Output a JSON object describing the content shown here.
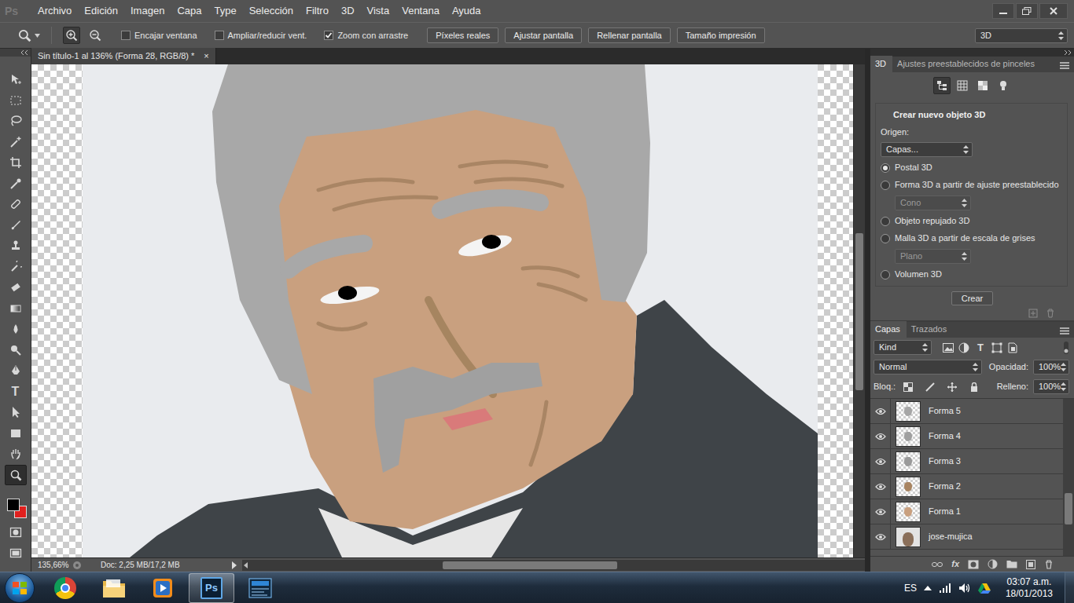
{
  "app_logo": "Ps",
  "menu": [
    "Archivo",
    "Edición",
    "Imagen",
    "Capa",
    "Type",
    "Selección",
    "Filtro",
    "3D",
    "Vista",
    "Ventana",
    "Ayuda"
  ],
  "options_bar": {
    "checkboxes": [
      {
        "label": "Encajar ventana",
        "checked": false
      },
      {
        "label": "Ampliar/reducir vent.",
        "checked": false
      },
      {
        "label": "Zoom con arrastre",
        "checked": true
      }
    ],
    "buttons": [
      "Píxeles reales",
      "Ajustar pantalla",
      "Rellenar pantalla",
      "Tamaño impresión"
    ],
    "workspace": "3D"
  },
  "document": {
    "tab_title": "Sin título-1 al 136% (Forma 28, RGB/8) *",
    "close": "×",
    "zoom": "135,66%",
    "doc_info": "Doc: 2,25 MB/17,2 MB"
  },
  "tools": [
    {
      "kind": "icon",
      "selected": false
    },
    {
      "kind": "icon",
      "selected": false
    },
    {
      "kind": "icon",
      "selected": false
    },
    {
      "kind": "icon",
      "selected": false
    },
    {
      "kind": "icon",
      "selected": false
    },
    {
      "kind": "icon",
      "selected": false
    },
    {
      "kind": "icon",
      "selected": false
    },
    {
      "kind": "icon",
      "selected": false
    },
    {
      "kind": "icon",
      "selected": false
    },
    {
      "kind": "icon",
      "selected": false
    },
    {
      "kind": "icon",
      "selected": false
    },
    {
      "kind": "icon",
      "selected": false
    },
    {
      "kind": "icon",
      "selected": false
    },
    {
      "kind": "icon",
      "selected": false
    },
    {
      "kind": "icon",
      "selected": false
    },
    {
      "kind": "glyph",
      "glyph": "T",
      "selected": false
    },
    {
      "kind": "icon",
      "selected": false
    },
    {
      "kind": "icon",
      "selected": false
    },
    {
      "kind": "icon",
      "selected": false
    },
    {
      "kind": "icon",
      "selected": true
    }
  ],
  "colors": {
    "foreground": "#000000",
    "background": "#e0201e"
  },
  "panel_3d": {
    "tabs": [
      {
        "label": "3D",
        "selected": true
      },
      {
        "label": "Ajustes preestablecidos de pinceles",
        "selected": false
      }
    ],
    "view_buttons": [
      {
        "selected": true
      },
      {
        "selected": false
      },
      {
        "selected": false
      },
      {
        "selected": false
      }
    ],
    "heading": "Crear nuevo objeto 3D",
    "source_label": "Origen:",
    "source": "Capas...",
    "options": [
      {
        "kind": "radio",
        "label": "Postal 3D",
        "selected": true,
        "disabled": false
      },
      {
        "kind": "radio",
        "label": "Forma 3D a partir de ajuste preestablecido",
        "selected": false,
        "disabled": false
      },
      {
        "kind": "select",
        "label": "Cono",
        "selected": false,
        "disabled": true
      },
      {
        "kind": "radio",
        "label": "Objeto repujado 3D",
        "selected": false,
        "disabled": false
      },
      {
        "kind": "radio",
        "label": "Malla 3D a partir de escala de grises",
        "selected": false,
        "disabled": false
      },
      {
        "kind": "select",
        "label": "Plano",
        "selected": false,
        "disabled": true
      },
      {
        "kind": "radio",
        "label": "Volumen 3D",
        "selected": false,
        "disabled": false
      }
    ],
    "button": "Crear"
  },
  "layers_panel": {
    "tabs": [
      {
        "label": "Capas",
        "selected": true
      },
      {
        "label": "Trazados",
        "selected": false
      }
    ],
    "filter": "Kind",
    "type_filter_glyph": "T",
    "blend_mode": "Normal",
    "opacity_label": "Opacidad:",
    "opacity": "100%",
    "lock_label": "Bloq.:",
    "fill_label": "Relleno:",
    "fill": "100%",
    "layers": [
      {
        "name": "Forma 5",
        "kind": "shape",
        "visible": true,
        "selected": false,
        "color": "#a6a6a6"
      },
      {
        "name": "Forma 4",
        "kind": "shape",
        "visible": true,
        "selected": false,
        "color": "#a0a0a0"
      },
      {
        "name": "Forma 3",
        "kind": "shape",
        "visible": true,
        "selected": false,
        "color": "#9a9a9a"
      },
      {
        "name": "Forma 2",
        "kind": "shape",
        "visible": true,
        "selected": false,
        "color": "#a88461"
      },
      {
        "name": "Forma 1",
        "kind": "shape",
        "visible": true,
        "selected": false,
        "color": "#c9a07f"
      },
      {
        "name": "jose-mujica",
        "kind": "photo",
        "visible": true,
        "selected": false,
        "color": "#8a6f5a"
      }
    ],
    "footer_fx": "fx"
  },
  "taskbar": {
    "apps": [
      {
        "kind": "icon",
        "selected": false
      },
      {
        "kind": "icon",
        "selected": false
      },
      {
        "kind": "icon",
        "selected": false
      },
      {
        "kind": "glyph",
        "glyph": "Ps",
        "selected": true
      },
      {
        "kind": "icon",
        "selected": false
      }
    ],
    "language": "ES",
    "time": "03:07 a.m.",
    "date": "18/01/2013"
  }
}
